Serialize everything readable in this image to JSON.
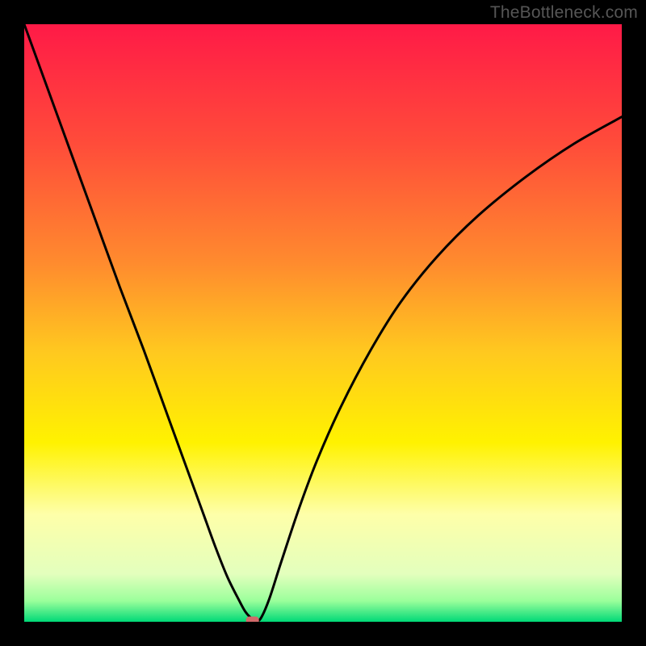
{
  "watermark": "TheBottleneck.com",
  "chart_data": {
    "type": "line",
    "title": "",
    "xlabel": "",
    "ylabel": "",
    "xlim": [
      0,
      100
    ],
    "ylim": [
      0,
      100
    ],
    "grid": false,
    "legend": false,
    "background_gradient": {
      "orientation": "vertical",
      "stops": [
        {
          "pos": 0.0,
          "color": "#ff1a47"
        },
        {
          "pos": 0.2,
          "color": "#ff4c3a"
        },
        {
          "pos": 0.4,
          "color": "#ff8b2e"
        },
        {
          "pos": 0.55,
          "color": "#ffc91f"
        },
        {
          "pos": 0.7,
          "color": "#fff200"
        },
        {
          "pos": 0.82,
          "color": "#feffa9"
        },
        {
          "pos": 0.92,
          "color": "#e3ffbd"
        },
        {
          "pos": 0.965,
          "color": "#9bff9b"
        },
        {
          "pos": 1.0,
          "color": "#00d977"
        }
      ]
    },
    "series": [
      {
        "name": "bottleneck-curve",
        "x": [
          0,
          4,
          8,
          12,
          16,
          20,
          24,
          28,
          30,
          32,
          34,
          36,
          37,
          38,
          38.8,
          39.6,
          41,
          43,
          46,
          49,
          53,
          58,
          63,
          69,
          76,
          84,
          92,
          100
        ],
        "y": [
          100,
          89,
          78,
          67,
          56,
          45.5,
          34.5,
          23.5,
          18,
          12.5,
          7.5,
          3.5,
          1.7,
          0.6,
          0.2,
          0.6,
          3.8,
          10,
          19,
          27,
          36,
          45.5,
          53.5,
          61,
          68,
          74.5,
          80,
          84.5
        ]
      }
    ],
    "marker": {
      "name": "optimal-point",
      "x": 38.2,
      "y": 0.2,
      "color": "#d16a6a",
      "shape": "rounded-rect"
    }
  }
}
